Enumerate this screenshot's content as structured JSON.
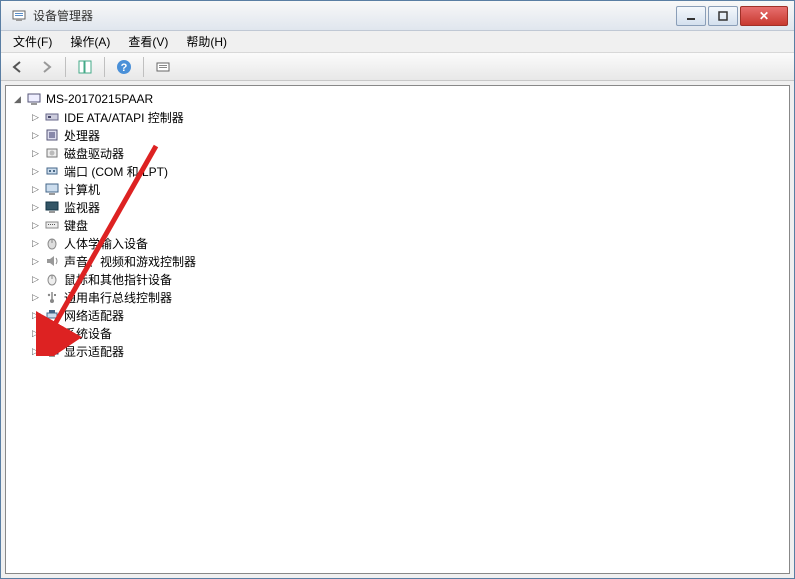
{
  "window": {
    "title": "设备管理器"
  },
  "menu": {
    "file": "文件(F)",
    "action": "操作(A)",
    "view": "查看(V)",
    "help": "帮助(H)"
  },
  "tree": {
    "root": "MS-20170215PAAR",
    "items": [
      {
        "id": "ide",
        "label": "IDE ATA/ATAPI 控制器"
      },
      {
        "id": "cpu",
        "label": "处理器"
      },
      {
        "id": "disk",
        "label": "磁盘驱动器"
      },
      {
        "id": "ports",
        "label": "端口 (COM 和 LPT)"
      },
      {
        "id": "computer",
        "label": "计算机"
      },
      {
        "id": "monitor",
        "label": "监视器"
      },
      {
        "id": "keyboard",
        "label": "键盘"
      },
      {
        "id": "hid",
        "label": "人体学输入设备"
      },
      {
        "id": "sound",
        "label": "声音、视频和游戏控制器"
      },
      {
        "id": "mouse",
        "label": "鼠标和其他指针设备"
      },
      {
        "id": "usb",
        "label": "通用串行总线控制器"
      },
      {
        "id": "network",
        "label": "网络适配器"
      },
      {
        "id": "system",
        "label": "系统设备"
      },
      {
        "id": "display",
        "label": "显示适配器"
      }
    ]
  }
}
